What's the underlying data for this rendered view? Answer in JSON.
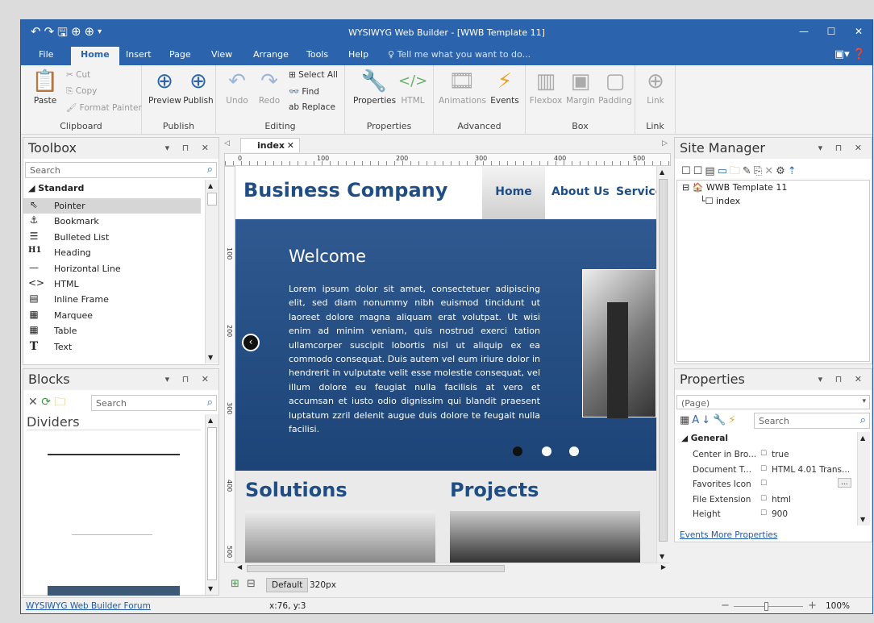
{
  "app": {
    "title": "WYSIWYG Web Builder - [WWB Template 11]"
  },
  "menu": {
    "tabs": [
      "File",
      "Home",
      "Insert",
      "Page",
      "View",
      "Arrange",
      "Tools",
      "Help"
    ],
    "active_tab": "Home",
    "tell_me": "Tell me what you want to do..."
  },
  "ribbon": {
    "clipboard": {
      "label": "Clipboard",
      "paste": "Paste",
      "cut": "Cut",
      "copy": "Copy",
      "format_painter": "Format Painter"
    },
    "publish": {
      "label": "Publish",
      "preview": "Preview",
      "publish": "Publish"
    },
    "editing": {
      "label": "Editing",
      "undo": "Undo",
      "redo": "Redo",
      "select_all": "Select All",
      "find": "Find",
      "replace": "Replace"
    },
    "properties": {
      "label": "Properties",
      "properties": "Properties",
      "html": "HTML"
    },
    "advanced": {
      "label": "Advanced",
      "animations": "Animations",
      "events": "Events"
    },
    "box": {
      "label": "Box",
      "flexbox": "Flexbox",
      "margin": "Margin",
      "padding": "Padding"
    },
    "link": {
      "label": "Link",
      "link": "Link"
    }
  },
  "toolbox": {
    "title": "Toolbox",
    "search_placeholder": "Search",
    "category": "Standard",
    "items": [
      {
        "label": "Pointer",
        "icon": "pointer-icon",
        "glyph": "⇖"
      },
      {
        "label": "Bookmark",
        "icon": "anchor-icon",
        "glyph": "⚓"
      },
      {
        "label": "Bulleted List",
        "icon": "list-icon",
        "glyph": "☰"
      },
      {
        "label": "Heading",
        "icon": "heading-icon",
        "glyph": "H1"
      },
      {
        "label": "Horizontal Line",
        "icon": "hline-icon",
        "glyph": "—"
      },
      {
        "label": "HTML",
        "icon": "code-icon",
        "glyph": "<>"
      },
      {
        "label": "Inline Frame",
        "icon": "iframe-icon",
        "glyph": "▤"
      },
      {
        "label": "Marquee",
        "icon": "marquee-icon",
        "glyph": "▦"
      },
      {
        "label": "Table",
        "icon": "table-icon",
        "glyph": "▦"
      },
      {
        "label": "Text",
        "icon": "text-icon",
        "glyph": "T"
      }
    ]
  },
  "blocks": {
    "title": "Blocks",
    "search_placeholder": "Search",
    "category": "Dividers"
  },
  "editor": {
    "tab_label": "index",
    "ruler_marks": [
      "0",
      "100",
      "200",
      "300",
      "400",
      "500"
    ],
    "vruler_marks": [
      "100",
      "200",
      "300",
      "400",
      "500"
    ],
    "breakpoint_label": "Default",
    "breakpoint_value": "320px"
  },
  "site": {
    "brand": "Business Company",
    "nav": [
      "Home",
      "About Us",
      "Service"
    ],
    "hero_title": "Welcome",
    "hero_text": "Lorem ipsum dolor sit amet, consectetuer adipiscing elit, sed diam nonummy nibh euismod tincidunt ut laoreet dolore magna aliquam erat volutpat. Ut wisi enim ad minim veniam, quis nostrud exerci tation ullamcorper suscipit lobortis nisl ut aliquip ex ea commodo consequat. Duis autem vel eum iriure dolor in hendrerit in vulputate velit esse molestie consequat, vel illum dolore eu feugiat nulla facilisis at vero et accumsan et iusto odio dignissim qui blandit praesent luptatum zzril delenit augue duis dolore te feugait nulla facilisi.",
    "section_solutions": "Solutions",
    "section_projects": "Projects"
  },
  "site_manager": {
    "title": "Site Manager",
    "root": "WWB Template 11",
    "page": "index"
  },
  "properties": {
    "title": "Properties",
    "selector": "(Page)",
    "search_placeholder": "Search",
    "section": "General",
    "rows": [
      {
        "key": "Center in Bro...",
        "value": "true"
      },
      {
        "key": "Document T...",
        "value": "HTML 4.01 Trans..."
      },
      {
        "key": "Favorites Icon",
        "value": ""
      },
      {
        "key": "File Extension",
        "value": "html"
      },
      {
        "key": "Height",
        "value": "900"
      }
    ],
    "link_events": "Events",
    "link_more": "More Properties"
  },
  "status": {
    "forum_link": "WYSIWYG Web Builder Forum",
    "coords": "x:76, y:3",
    "zoom": "100%"
  },
  "colors": {
    "accent": "#2b64ad",
    "hero": "#234e84",
    "brand_text": "#1f4e86"
  }
}
